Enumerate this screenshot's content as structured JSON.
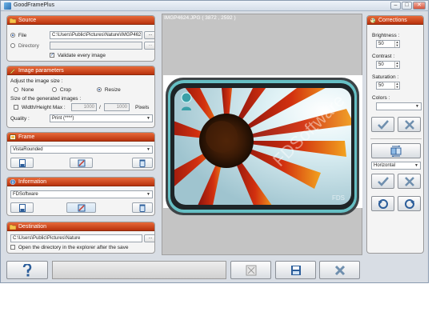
{
  "window": {
    "title": "GoodFramePlus",
    "buttons": [
      "–",
      "□",
      "✕"
    ]
  },
  "source": {
    "header": "Source",
    "file_label": "File",
    "file_path": "C:\\Users\\Public\\Pictures\\Nature\\IMGP462",
    "directory_label": "Directory",
    "directory_path": "",
    "browse_label": "...",
    "validate_label": "Validate every image",
    "validate_checked": true
  },
  "image_parameters": {
    "header": "Image parameters",
    "adjust_label": "Adjust the image size :",
    "options": [
      "None",
      "Crop",
      "Resize"
    ],
    "selected": "Resize",
    "size_label": "Size of the generated images :",
    "width_height_label": "Width/Height Max :",
    "width": "1000",
    "sep": "/",
    "height": "1000",
    "units": "Pixels",
    "quality_label": "Quality :",
    "quality_value": "Print (****)"
  },
  "frame": {
    "header": "Frame",
    "value": "VistaRounded"
  },
  "information": {
    "header": "Information",
    "value": "FDSoftware"
  },
  "destination": {
    "header": "Destination",
    "path": "C:\\Users\\Public\\Pictures\\Nature",
    "browse_label": "...",
    "open_label": "Open the directory in the explorer after the save"
  },
  "viewer": {
    "title": "IMGP4624.JPG ( 3872 , 2592 )",
    "watermark": "FDSoftware",
    "corner_text": "FDS"
  },
  "corrections": {
    "header": "Corrections",
    "brightness_label": "Brightness :",
    "brightness": "50",
    "contrast_label": "Contrast :",
    "contrast": "50",
    "saturation_label": "Saturation :",
    "saturation": "50",
    "colors_label": "Colors :",
    "colors_value": "",
    "flip_value": "Horizontal"
  },
  "colors": {
    "header_start": "#e86a3a",
    "header_end": "#b8320d",
    "check_green": "#2f8f3f",
    "cross_blue": "#2b5d9a"
  }
}
